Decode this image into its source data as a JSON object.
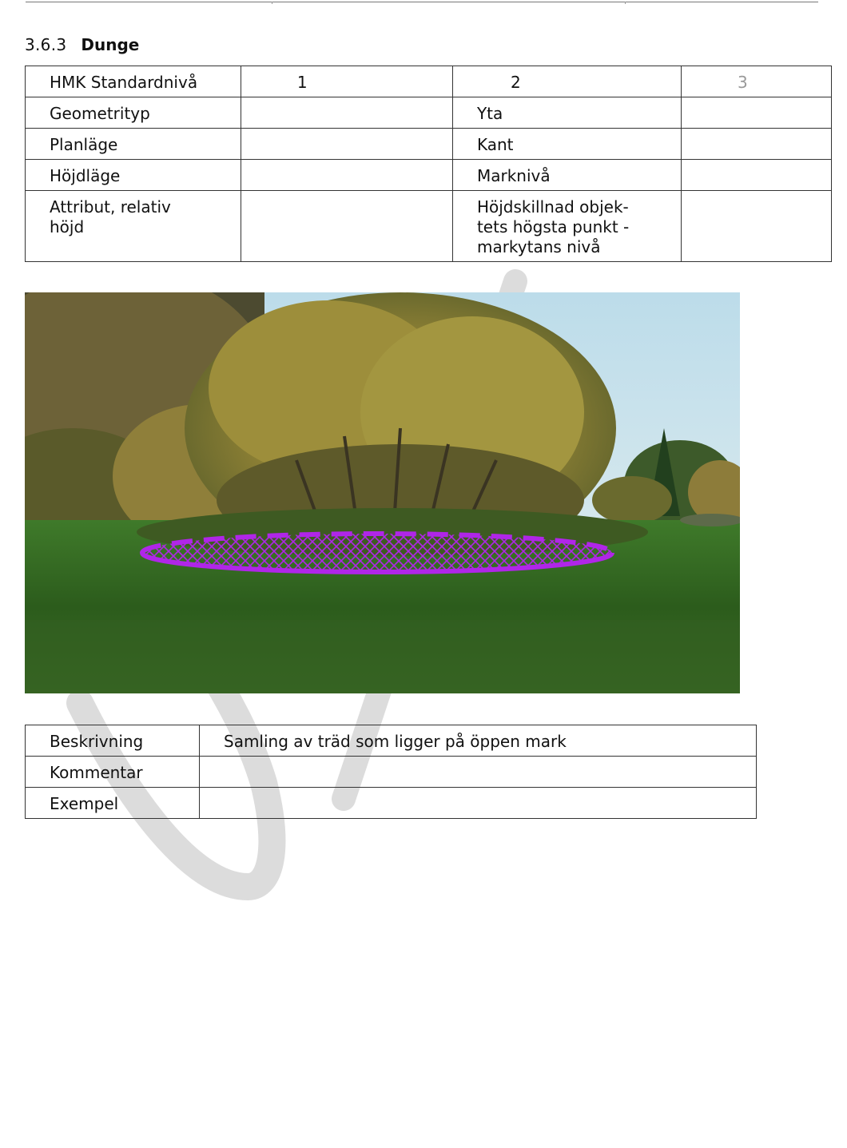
{
  "section": {
    "number": "3.6.3",
    "title": "Dunge"
  },
  "spec_table": {
    "header": {
      "label": "HMK Standardnivå",
      "levels": [
        "1",
        "2",
        "3"
      ]
    },
    "rows": [
      {
        "label": "Geometrityp",
        "level2": "Yta"
      },
      {
        "label": "Planläge",
        "level2": "Kant"
      },
      {
        "label": "Höjdläge",
        "level2": "Marknivå"
      },
      {
        "label": "Attribut, relativ höjd",
        "level2": "Höjdskillnad objek-tets högsta punkt - markytans nivå"
      }
    ]
  },
  "photo": {
    "overlay_color": "#b026e8",
    "scene": "grove-of-trees-on-meadow"
  },
  "description_table": {
    "rows": [
      {
        "label": "Beskrivning",
        "value": "Samling av träd som ligger på öppen mark"
      },
      {
        "label": "Kommentar",
        "value": ""
      },
      {
        "label": "Exempel",
        "value": ""
      }
    ]
  },
  "colors": {
    "text": "#111111",
    "border": "#333333",
    "level3": "#999999",
    "watermark": "#d9d9d9"
  }
}
